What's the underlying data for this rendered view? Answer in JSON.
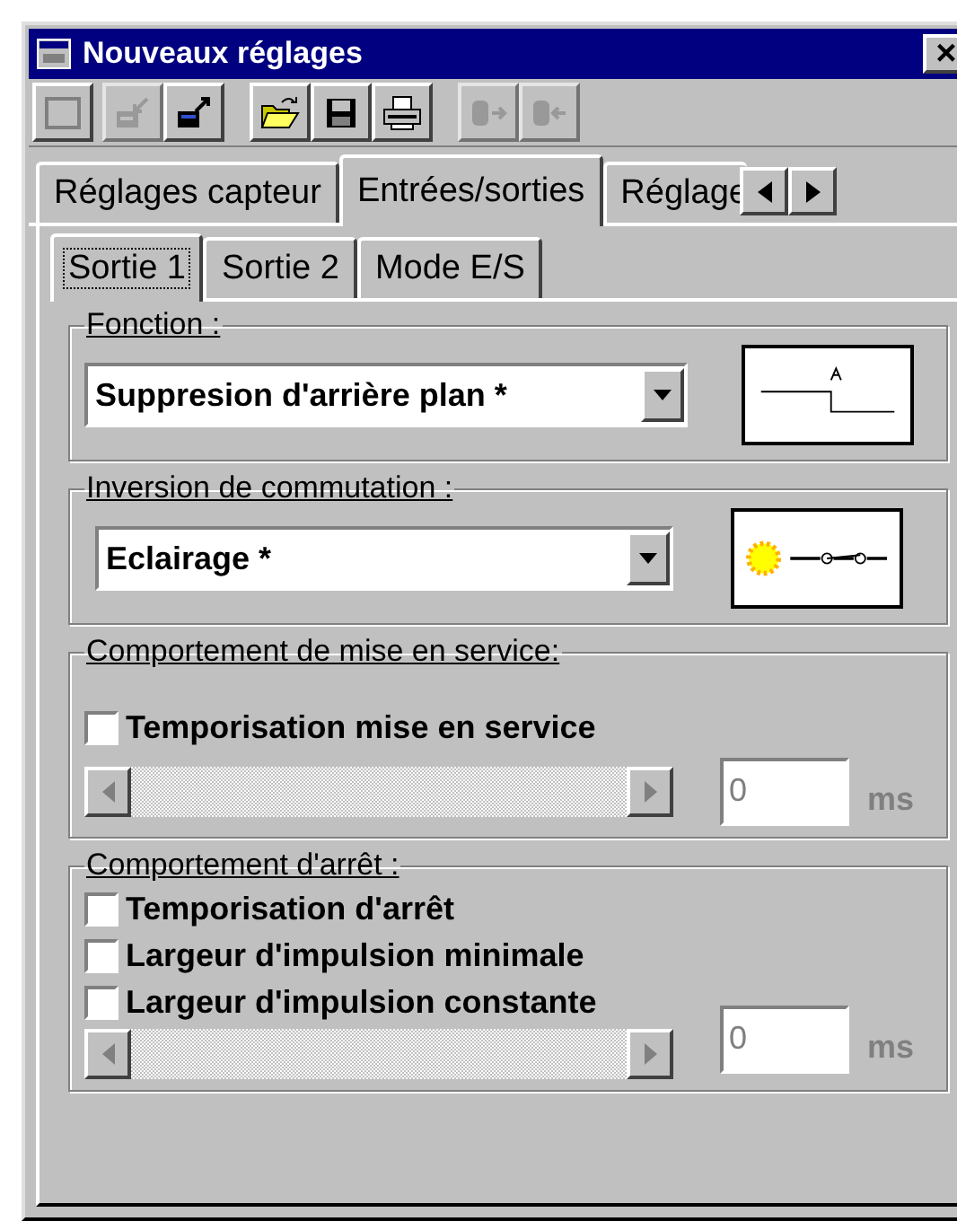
{
  "window": {
    "title": "Nouveaux réglages",
    "close": "×"
  },
  "toolbar": [
    {
      "kind": "blank",
      "disabled": false
    },
    {
      "kind": "import",
      "disabled": true
    },
    {
      "kind": "export",
      "disabled": false
    },
    {
      "kind": "open",
      "disabled": false
    },
    {
      "kind": "save",
      "disabled": false
    },
    {
      "kind": "print",
      "disabled": false
    },
    {
      "kind": "send",
      "disabled": true
    },
    {
      "kind": "receive",
      "disabled": true
    }
  ],
  "tabs": [
    {
      "label": "Réglages capteur",
      "selected": false
    },
    {
      "label": "Entrées/sorties",
      "selected": true
    },
    {
      "label": "Réglage",
      "selected": false
    }
  ],
  "subtabs": [
    {
      "label": "Sortie 1",
      "selected": true
    },
    {
      "label": "Sortie 2",
      "selected": false
    },
    {
      "label": "Mode E/S",
      "selected": false
    }
  ],
  "function": {
    "label": "Fonction :",
    "value": "Suppresion d'arrière plan *"
  },
  "inversion": {
    "label": "Inversion de commutation :",
    "value": "Eclairage *"
  },
  "switch_on": {
    "label": "Comportement de mise en service:",
    "options": [
      {
        "label": "Temporisation mise en service",
        "checked": false
      }
    ],
    "delay": {
      "value": "0",
      "unit": "ms",
      "disabled": true
    }
  },
  "switch_off": {
    "label": "Comportement d'arrêt :",
    "options": [
      {
        "label": "Temporisation d'arrêt",
        "checked": false
      },
      {
        "label": "Largeur d'impulsion minimale",
        "checked": false
      },
      {
        "label": "Largeur d'impulsion constante",
        "checked": false
      }
    ],
    "delay": {
      "value": "0",
      "unit": "ms",
      "disabled": true
    }
  }
}
